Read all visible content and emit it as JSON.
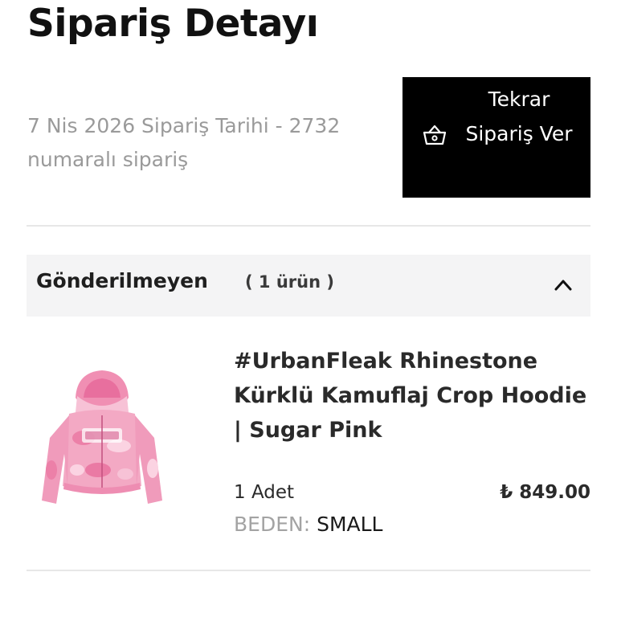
{
  "page": {
    "title": "Sipariş Detayı"
  },
  "order": {
    "meta_line": "7 Nis 2026 Sipariş Tarihi - 2732 numaralı sipariş"
  },
  "reorder_button": {
    "label": "Tekrar Sipariş Ver",
    "icon": "basket-icon"
  },
  "section": {
    "title": "Gönderilmeyen",
    "count_label": "( 1 ürün )",
    "expanded": true,
    "toggle_icon": "chevron-up-icon"
  },
  "items": [
    {
      "name": "#UrbanFleak Rhinestone Kürklü Kamuflaj Crop Hoodie | Sugar Pink",
      "quantity_label": "1 Adet",
      "price": "₺ 849.00",
      "size_label": "BEDEN:",
      "size_value": "SMALL",
      "image": "pink-camo-hoodie-image"
    }
  ],
  "colors": {
    "button_bg": "#000000",
    "section_bg": "#f4f4f5",
    "muted_text": "#9a9a9a",
    "hoodie_pink": "#f3a9c4"
  }
}
